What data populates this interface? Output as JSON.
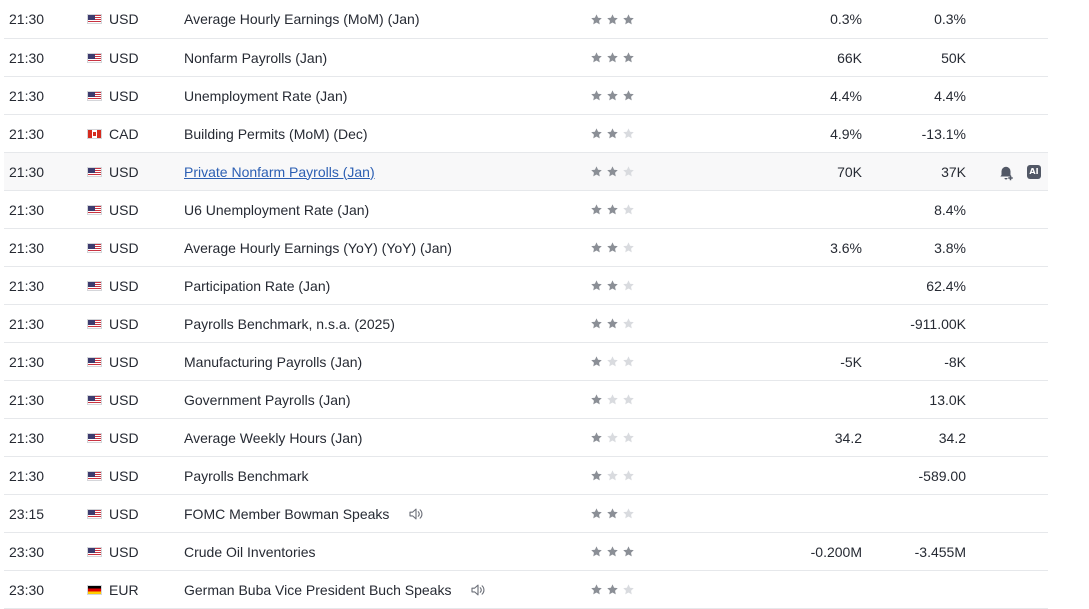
{
  "colors": {
    "star_filled": "#8b8f96",
    "star_empty": "#d9dbdf",
    "link": "#2c5fb3",
    "row_border": "#e6e8eb",
    "hover_bg": "#f8f8f9"
  },
  "events": [
    {
      "time": "21:30",
      "flag": "us",
      "currency": "USD",
      "event": "Average Hourly Earnings (MoM) (Jan)",
      "importance": 3,
      "actual": "0.3%",
      "forecast": "0.3%"
    },
    {
      "time": "21:30",
      "flag": "us",
      "currency": "USD",
      "event": "Nonfarm Payrolls  (Jan)",
      "importance": 3,
      "actual": "66K",
      "forecast": "50K"
    },
    {
      "time": "21:30",
      "flag": "us",
      "currency": "USD",
      "event": "Unemployment Rate  (Jan)",
      "importance": 3,
      "actual": "4.4%",
      "forecast": "4.4%"
    },
    {
      "time": "21:30",
      "flag": "ca",
      "currency": "CAD",
      "event": "Building Permits (MoM) (Dec)",
      "importance": 2,
      "actual": "4.9%",
      "forecast": "-13.1%"
    },
    {
      "time": "21:30",
      "flag": "us",
      "currency": "USD",
      "event": "Private Nonfarm Payrolls  (Jan)",
      "importance": 2,
      "actual": "70K",
      "forecast": "37K",
      "link": true,
      "hover": true,
      "actions": [
        "bell-plus-icon",
        "ai-icon"
      ]
    },
    {
      "time": "21:30",
      "flag": "us",
      "currency": "USD",
      "event": "U6 Unemployment Rate  (Jan)",
      "importance": 2,
      "actual": "",
      "forecast": "8.4%"
    },
    {
      "time": "21:30",
      "flag": "us",
      "currency": "USD",
      "event": "Average Hourly Earnings (YoY) (YoY) (Jan)",
      "importance": 2,
      "actual": "3.6%",
      "forecast": "3.8%"
    },
    {
      "time": "21:30",
      "flag": "us",
      "currency": "USD",
      "event": "Participation Rate  (Jan)",
      "importance": 2,
      "actual": "",
      "forecast": "62.4%"
    },
    {
      "time": "21:30",
      "flag": "us",
      "currency": "USD",
      "event": "Payrolls Benchmark, n.s.a.  (2025)",
      "importance": 2,
      "actual": "",
      "forecast": "-911.00K"
    },
    {
      "time": "21:30",
      "flag": "us",
      "currency": "USD",
      "event": "Manufacturing Payrolls  (Jan)",
      "importance": 1,
      "actual": "-5K",
      "forecast": "-8K"
    },
    {
      "time": "21:30",
      "flag": "us",
      "currency": "USD",
      "event": "Government Payrolls  (Jan)",
      "importance": 1,
      "actual": "",
      "forecast": "13.0K"
    },
    {
      "time": "21:30",
      "flag": "us",
      "currency": "USD",
      "event": "Average Weekly Hours  (Jan)",
      "importance": 1,
      "actual": "34.2",
      "forecast": "34.2"
    },
    {
      "time": "21:30",
      "flag": "us",
      "currency": "USD",
      "event": "Payrolls Benchmark",
      "importance": 1,
      "actual": "",
      "forecast": "-589.00"
    },
    {
      "time": "23:15",
      "flag": "us",
      "currency": "USD",
      "event": "FOMC Member Bowman Speaks",
      "importance": 2,
      "actual": "",
      "forecast": "",
      "speech": true
    },
    {
      "time": "23:30",
      "flag": "us",
      "currency": "USD",
      "event": "Crude Oil Inventories",
      "importance": 3,
      "actual": "-0.200M",
      "forecast": "-3.455M"
    },
    {
      "time": "23:30",
      "flag": "de",
      "currency": "EUR",
      "event": "German Buba Vice President Buch Speaks",
      "importance": 2,
      "actual": "",
      "forecast": "",
      "speech": true
    }
  ],
  "ai_badge_label": "AI"
}
